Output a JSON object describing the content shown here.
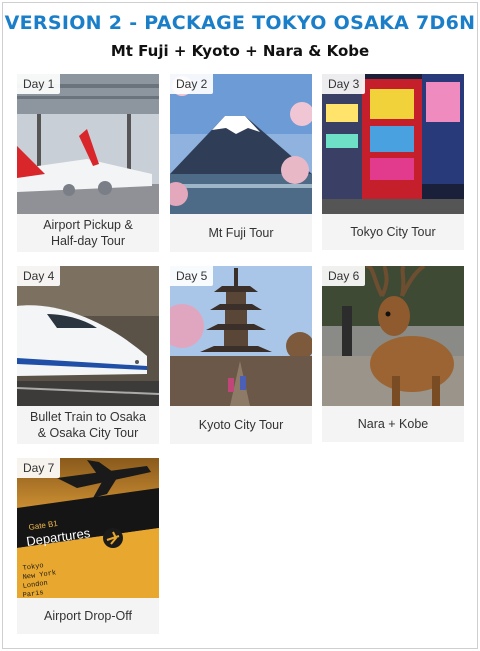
{
  "header": {
    "title": "VERSION 2 - PACKAGE TOKYO OSAKA 7D6N",
    "subtitle": "Mt Fuji + Kyoto + Nara & Kobe"
  },
  "days": [
    {
      "day": "Day 1",
      "caption": "Airport Pickup &\nHalf-day Tour"
    },
    {
      "day": "Day 2",
      "caption": "Mt Fuji Tour"
    },
    {
      "day": "Day 3",
      "caption": "Tokyo City Tour"
    },
    {
      "day": "Day 4",
      "caption": "Bullet Train to Osaka\n& Osaka City Tour"
    },
    {
      "day": "Day 5",
      "caption": "Kyoto City Tour"
    },
    {
      "day": "Day 6",
      "caption": "Nara + Kobe"
    },
    {
      "day": "Day 7",
      "caption": "Airport Drop-Off"
    }
  ],
  "departures_sign": {
    "gate": "Gate B1",
    "label": "Departures",
    "cities": [
      "Tokyo",
      "New York",
      "London",
      "Paris"
    ]
  },
  "colors": {
    "title": "#1a7fc8",
    "card_bg": "#f4f4f4"
  },
  "icons": [
    "airplane-icon"
  ]
}
